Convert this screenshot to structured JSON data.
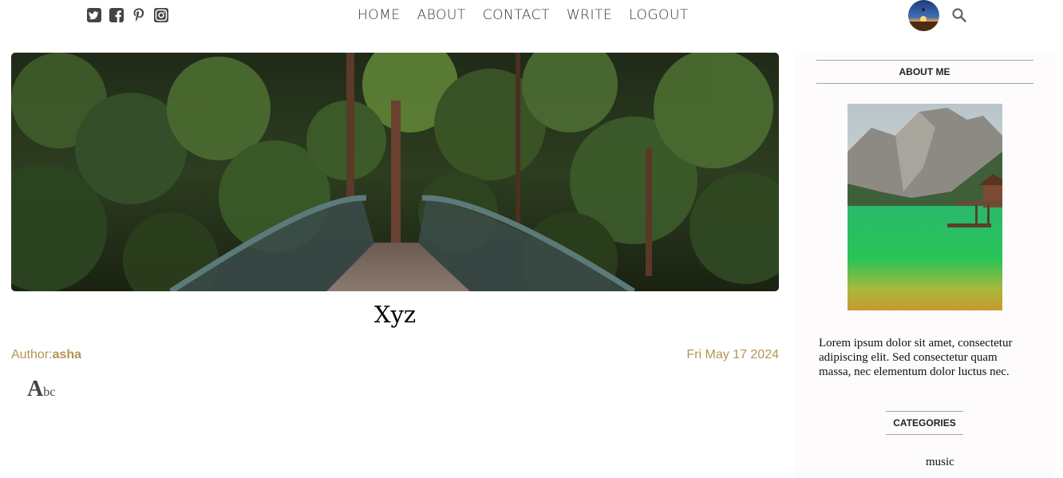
{
  "header": {
    "social_icons": [
      "twitter-square-icon",
      "facebook-square-icon",
      "pinterest-icon",
      "instagram-icon"
    ],
    "nav": {
      "home": "HOME",
      "about": "ABOUT",
      "contact": "CONTACT",
      "write": "WRITE",
      "logout": "LOGOUT"
    },
    "search_icon": "search-icon"
  },
  "post": {
    "title": "Xyz",
    "author_label": "Author:",
    "author": "asha",
    "date": "Fri May 17 2024",
    "desc_first_letter": "A",
    "desc_rest": "bc"
  },
  "sidebar": {
    "about_title": "ABOUT ME",
    "about_text": "Lorem ipsum dolor sit amet, consectetur adipiscing elit. Sed consectetur quam massa, nec elementum dolor luctus nec.",
    "categories_title": "CATEGORIES",
    "categories": [
      "music"
    ]
  },
  "colors": {
    "accent": "#b39656",
    "sidebar_bg": "#fdfbfb",
    "divider": "#a7a4a4"
  }
}
